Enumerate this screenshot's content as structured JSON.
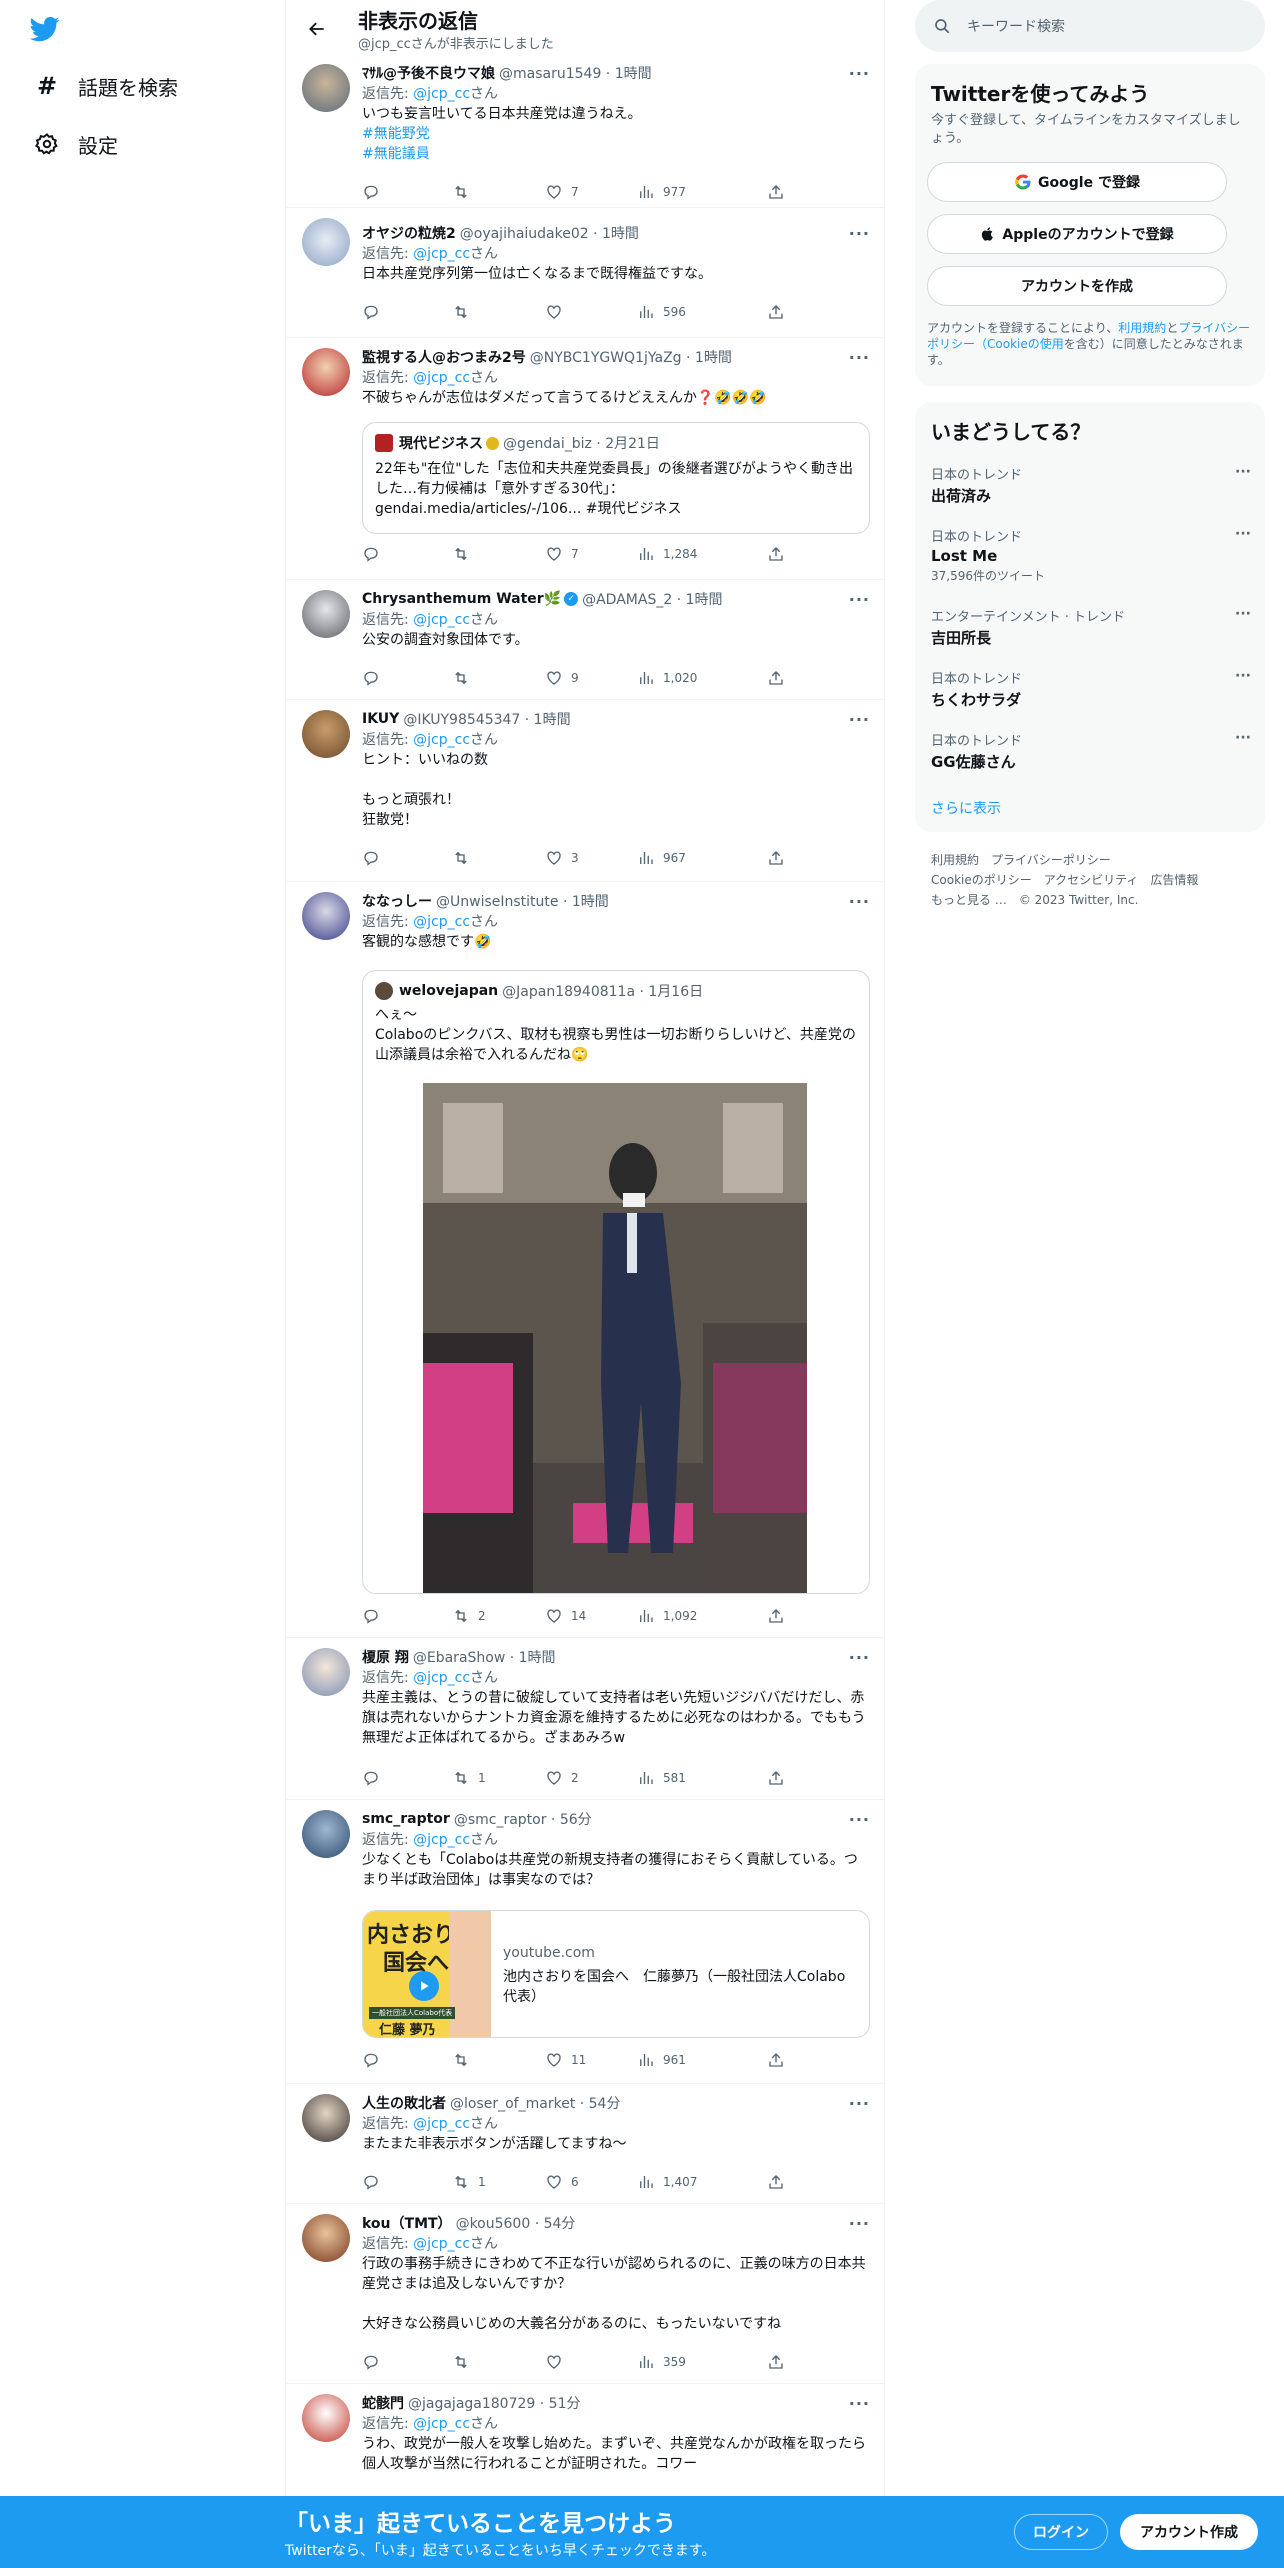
{
  "nav": {
    "explore": "話題を検索",
    "settings": "設定"
  },
  "header": {
    "title": "非表示の返信",
    "subtitle": "@jcp_ccさんが非表示にしました"
  },
  "reply_prefix": "返信先: ",
  "reply_target": "@jcp_cc",
  "reply_suffix": "さん",
  "tweets": [
    {
      "name": "ﾏｻﾙ@予後不良ウマ娘",
      "handle": "@masaru1549 · 1時間",
      "text": "いつも妄言吐いてる日本共産党は違うねえ。",
      "tags": [
        "#無能野党",
        "#無能議員"
      ],
      "reply": "",
      "retweet": "",
      "like": "7",
      "views": "977"
    },
    {
      "name": "オヤジの粒焼2",
      "handle": "@oyajihaiudake02 · 1時間",
      "text": "日本共産党序列第一位は亡くなるまで既得権益ですな。",
      "reply": "",
      "retweet": "",
      "like": "",
      "views": "596"
    },
    {
      "name": "監視する人@おつまみ2号",
      "handle": "@NYBC1YGWQ1jYaZg · 1時間",
      "text": "不破ちゃんが志位はダメだって言うてるけどええんか❓🤣🤣🤣",
      "reply": "",
      "retweet": "",
      "like": "7",
      "views": "1,284"
    },
    {
      "name": "Chrysanthemum Water🌿",
      "handle": "@ADAMAS_2 · 1時間",
      "text": "公安の調査対象団体です。",
      "reply": "",
      "retweet": "",
      "like": "9",
      "views": "1,020"
    },
    {
      "name": "IKUY",
      "handle": "@IKUY98545347 · 1時間",
      "text": "ヒント：いいねの数\n\nもっと頑張れ！\n狂散党！",
      "reply": "",
      "retweet": "",
      "like": "3",
      "views": "967"
    },
    {
      "name": "ななっしー",
      "handle": "@UnwiseInstitute · 1時間",
      "text": "客観的な感想です🤣",
      "reply": "",
      "retweet": "2",
      "like": "14",
      "views": "1,092"
    },
    {
      "name": "榎原 翔",
      "handle": "@EbaraShow · 1時間",
      "text": "共産主義は、とうの昔に破綻していて支持者は老い先短いジジババだけだし、赤旗は売れないからナントカ資金源を維持するために必死なのはわかる。でももう無理だよ正体ばれてるから。ざまあみろw",
      "reply": "",
      "retweet": "1",
      "like": "2",
      "views": "581"
    },
    {
      "name": "smc_raptor",
      "handle": "@smc_raptor · 56分",
      "text": "少なくとも「Colaboは共産党の新規支持者の獲得におそらく貢献している。つまり半ば政治団体」は事実なのでは？",
      "reply": "",
      "retweet": "",
      "like": "11",
      "views": "961"
    },
    {
      "name": "人生の敗北者",
      "handle": "@loser_of_market · 54分",
      "text": "またまた非表示ボタンが活躍してますね〜",
      "reply": "",
      "retweet": "1",
      "like": "6",
      "views": "1,407"
    },
    {
      "name": "kou（TMT）",
      "handle": "@kou5600 · 54分",
      "text": "行政の事務手続きにきわめて不正な行いが認められるのに、正義の味方の日本共産党さまは追及しないんですか？\n\n大好きな公務員いじめの大義名分があるのに、もったいないですね",
      "reply": "",
      "retweet": "",
      "like": "",
      "views": "359"
    },
    {
      "name": "蛇骸門",
      "handle": "@jagajaga180729 · 51分",
      "text": "うわ、政党が一般人を攻撃し始めた。まずいぞ、共産党なんかが政権を取ったら個人攻撃が当然に行われることが証明された。コワー"
    }
  ],
  "quote1": {
    "name": "現代ビジネス",
    "handle": "@gendai_biz · 2月21日",
    "text": "22年も\"在位\"した「志位和夫共産党委員長」の後継者選びがようやく動き出した…有力候補は「意外すぎる30代」：\ngendai.media/articles/-/106... #現代ビジネス"
  },
  "quote2": {
    "name": "welovejapan",
    "handle": "@Japan18940811a · 1月16日",
    "text": "へぇ〜\nColaboのピンクバス、取材も視察も男性は一切お断りらしいけど、共産党の山添議員は余裕で入れるんだね🙄"
  },
  "linkcard": {
    "domain": "youtube.com",
    "title": "池内さおりを国会へ　仁藤夢乃（一般社団法人Colabo代表）",
    "thumb_line1": "内さおりを",
    "thumb_line2": "国会へ",
    "thumb_small": "一般社団法人Colabo代表",
    "thumb_name": "仁藤 夢乃"
  },
  "search": {
    "placeholder": "キーワード検索"
  },
  "signup_card": {
    "title": "Twitterを使ってみよう",
    "sub": "今すぐ登録して、タイムラインをカスタマイズしましょう。",
    "google": "Google で登録",
    "apple": "Appleのアカウントで登録",
    "create": "アカウントを作成",
    "terms_pre": "アカウントを登録することにより、",
    "terms_link1": "利用規約",
    "terms_mid": "と",
    "terms_link2": "プライバシーポリシー（Cookieの使用",
    "terms_post": "を含む）に同意したとみなされます。"
  },
  "trends_card": {
    "title": "いまどうしてる？",
    "items": [
      {
        "cat": "日本のトレンド",
        "name": "出荷済み",
        "count": ""
      },
      {
        "cat": "日本のトレンド",
        "name": "Lost Me",
        "count": "37,596件のツイート"
      },
      {
        "cat": "エンターテインメント · トレンド",
        "name": "吉田所長",
        "count": ""
      },
      {
        "cat": "日本のトレンド",
        "name": "ちくわサラダ",
        "count": ""
      },
      {
        "cat": "日本のトレンド",
        "name": "GG佐藤さん",
        "count": ""
      }
    ],
    "more": "さらに表示"
  },
  "footer": {
    "line1": "利用規約　プライバシーポリシー",
    "line2": "Cookieのポリシー　アクセシビリティ　広告情報",
    "line3": "もっと見る …　© 2023 Twitter, Inc."
  },
  "bottom": {
    "title": "「いま」起きていることを見つけよう",
    "sub": "Twitterなら、「いま」起きていることをいち早くチェックできます。",
    "login": "ログイン",
    "signup": "アカウント作成"
  },
  "colors": {
    "accent": "#1d9bf0",
    "bottom_bar": "#1d9bf0"
  }
}
